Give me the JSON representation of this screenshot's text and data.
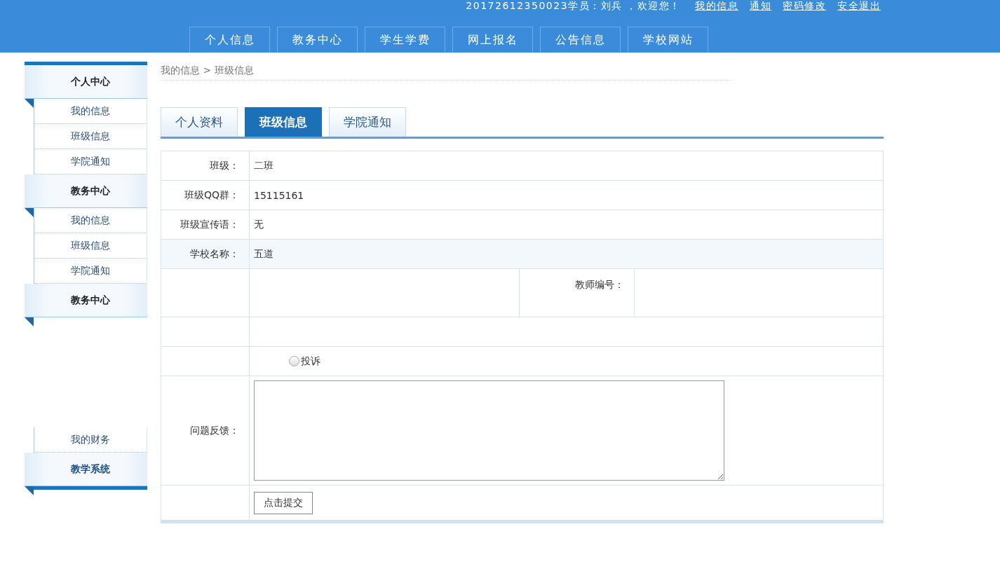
{
  "header": {
    "welcome": "20172612350023学员：刘兵 ，欢迎您！",
    "links": [
      "我的信息",
      "通知",
      "密码修改",
      "安全退出"
    ]
  },
  "nav": [
    {
      "label": "个人信息",
      "selected": false
    },
    {
      "label": "教务中心",
      "selected": false
    },
    {
      "label": "学生学费",
      "selected": false
    },
    {
      "label": "网上报名",
      "selected": false
    },
    {
      "label": "公告信息",
      "selected": false
    },
    {
      "label": "学校网站",
      "selected": false
    }
  ],
  "sidebar": [
    {
      "kind": "header",
      "label": "个人中心"
    },
    {
      "kind": "item",
      "label": "我的信息"
    },
    {
      "kind": "item",
      "label": "班级信息"
    },
    {
      "kind": "item",
      "label": "学院通知"
    },
    {
      "kind": "header",
      "label": "教务中心"
    },
    {
      "kind": "item",
      "label": "我的信息"
    },
    {
      "kind": "item",
      "label": "班级信息"
    },
    {
      "kind": "item",
      "label": "学院通知"
    },
    {
      "kind": "header",
      "label": "教务中心"
    },
    {
      "kind": "hidden_item"
    },
    {
      "kind": "hidden_item"
    },
    {
      "kind": "hidden_item"
    },
    {
      "kind": "hidden_header"
    },
    {
      "kind": "item",
      "label": "我的财务"
    },
    {
      "kind": "header",
      "label": "教学系统",
      "accent": true
    }
  ],
  "breadcrumb": "我的信息 > 班级信息",
  "tabs": [
    {
      "label": "个人资料",
      "selected": false
    },
    {
      "label": "班级信息",
      "selected": true
    },
    {
      "label": "学院通知",
      "selected": false
    }
  ],
  "rows": [
    {
      "kind": "text",
      "label": "班级：",
      "value": "二班"
    },
    {
      "kind": "text",
      "label": "班级QQ群：",
      "value": "15115161"
    },
    {
      "kind": "text",
      "label": "班级宣传语：",
      "value": "无"
    },
    {
      "kind": "text",
      "label": "学校名称：",
      "value": "五道",
      "highlight": true
    },
    {
      "kind": "pair",
      "label2": "教师编号："
    },
    {
      "kind": "empty"
    },
    {
      "kind": "radio",
      "options": [
        {
          "label": "投诉",
          "selected": false
        }
      ]
    },
    {
      "kind": "textarea",
      "label": "问题反馈："
    },
    {
      "kind": "button",
      "button": "点击提交"
    }
  ]
}
